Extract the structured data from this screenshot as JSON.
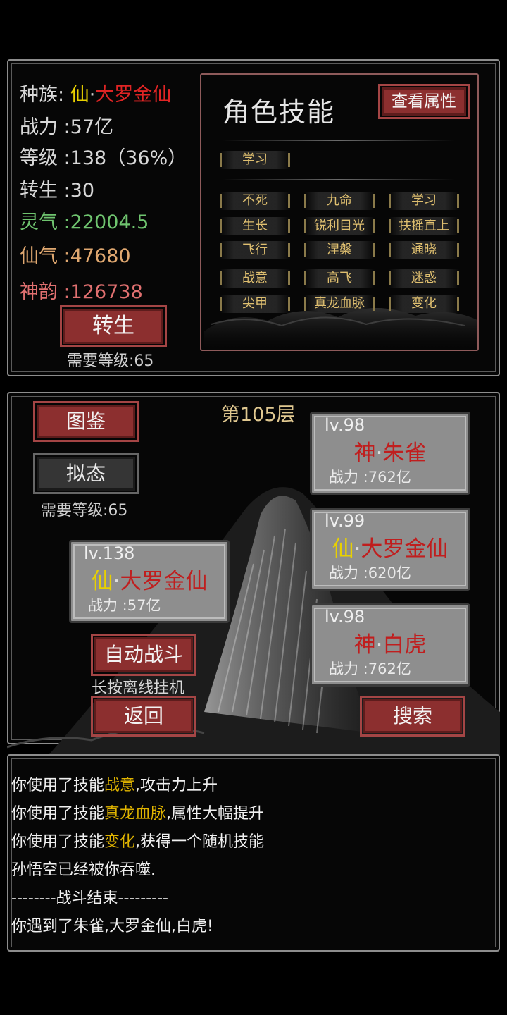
{
  "stats": {
    "race_label": "种族:",
    "race_prefix": "仙",
    "race_dot": "·",
    "race_name": "大罗金仙",
    "power": "战力 :57亿",
    "level": "等级 :138（36%）",
    "rebirth": "转生 :30",
    "lingqi": "灵气 :22004.5",
    "xianqi": "仙气 :47680",
    "shenyun": "神韵 :126738"
  },
  "rebirth_button": {
    "label": "转生",
    "requirement": "需要等级:65"
  },
  "skills_panel": {
    "title": "角色技能",
    "view_attr_button": "查看属性",
    "learn_slot": "学习",
    "skills": [
      "不死",
      "九命",
      "学习",
      "生长",
      "锐利目光",
      "扶摇直上",
      "飞行",
      "涅槃",
      "通晓",
      "战意",
      "高飞",
      "迷惑",
      "尖甲",
      "真龙血脉",
      "变化"
    ]
  },
  "battle": {
    "floor": "第105层",
    "codex_button": "图鉴",
    "mimic_button": "拟态",
    "mimic_requirement": "需要等级:65",
    "auto_battle_button": "自动战斗",
    "auto_hint": "长按离线挂机",
    "back_button": "返回",
    "search_button": "搜索",
    "player": {
      "lv": "lv.138",
      "prefix": "仙",
      "dot": "·",
      "name": "大罗金仙",
      "power": "战力 :57亿"
    },
    "enemies": [
      {
        "lv": "lv.98",
        "prefix": "神",
        "dot": "·",
        "name": "朱雀",
        "power": "战力 :762亿"
      },
      {
        "lv": "lv.99",
        "prefix": "仙",
        "dot": "·",
        "name": "大罗金仙",
        "power": "战力 :620亿"
      },
      {
        "lv": "lv.98",
        "prefix": "神",
        "dot": "·",
        "name": "白虎",
        "power": "战力 :762亿"
      }
    ]
  },
  "log": {
    "line1_a": "你使用了技能",
    "line1_b": "战意",
    "line1_c": ",攻击力上升",
    "line2_a": "你使用了技能",
    "line2_b": "真龙血脉",
    "line2_c": ",属性大幅提升",
    "line3_a": "你使用了技能",
    "line3_b": "变化",
    "line3_c": ",获得一个随机技能",
    "line4": "孙悟空已经被你吞噬.",
    "line5": "--------战斗结束---------",
    "line6": "你遇到了朱雀,大罗金仙,白虎!"
  },
  "colors": {
    "red_button": "#8c2f2f",
    "gold_text": "#e0c070",
    "red_name": "#c01e1e",
    "yellow_name": "#e8d000",
    "green": "#6fc46f",
    "orange": "#e0a870",
    "rose": "#e07070",
    "log_highlight": "#e0b400"
  },
  "icons": [
    "mountain-decor",
    "cloud-decor"
  ]
}
